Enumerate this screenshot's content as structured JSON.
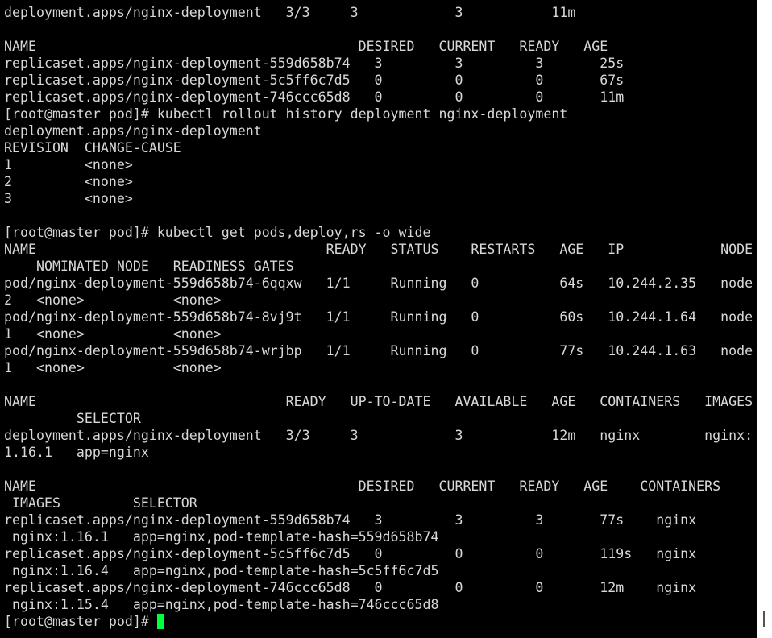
{
  "colors": {
    "background": "#000000",
    "foreground": "#d8d8d8",
    "cursor": "#00ff3c",
    "scrollbar": "#ffffff"
  },
  "terminal": {
    "lines": [
      "deployment.apps/nginx-deployment   3/3     3            3           11m",
      "",
      "NAME                                        DESIRED   CURRENT   READY   AGE",
      "replicaset.apps/nginx-deployment-559d658b74   3         3         3       25s",
      "replicaset.apps/nginx-deployment-5c5ff6c7d5   0         0         0       67s",
      "replicaset.apps/nginx-deployment-746ccc65d8   0         0         0       11m",
      "[root@master pod]# kubectl rollout history deployment nginx-deployment",
      "deployment.apps/nginx-deployment",
      "REVISION  CHANGE-CAUSE",
      "1         <none>",
      "2         <none>",
      "3         <none>",
      "",
      "[root@master pod]# kubectl get pods,deploy,rs -o wide",
      "NAME                                    READY   STATUS    RESTARTS   AGE   IP            NODE",
      "    NOMINATED NODE   READINESS GATES",
      "pod/nginx-deployment-559d658b74-6qqxw   1/1     Running   0          64s   10.244.2.35   node",
      "2   <none>           <none>",
      "pod/nginx-deployment-559d658b74-8vj9t   1/1     Running   0          60s   10.244.1.64   node",
      "1   <none>           <none>",
      "pod/nginx-deployment-559d658b74-wrjbp   1/1     Running   0          77s   10.244.1.63   node",
      "1   <none>           <none>",
      "",
      "NAME                               READY   UP-TO-DATE   AVAILABLE   AGE   CONTAINERS   IMAGES",
      "         SELECTOR",
      "deployment.apps/nginx-deployment   3/3     3            3           12m   nginx        nginx:",
      "1.16.1   app=nginx",
      "",
      "NAME                                        DESIRED   CURRENT   READY   AGE    CONTAINERS",
      " IMAGES         SELECTOR",
      "replicaset.apps/nginx-deployment-559d658b74   3         3         3       77s    nginx",
      " nginx:1.16.1   app=nginx,pod-template-hash=559d658b74",
      "replicaset.apps/nginx-deployment-5c5ff6c7d5   0         0         0       119s   nginx",
      " nginx:1.16.4   app=nginx,pod-template-hash=5c5ff6c7d5",
      "replicaset.apps/nginx-deployment-746ccc65d8   0         0         0       12m    nginx",
      " nginx:1.15.4   app=nginx,pod-template-hash=746ccc65d8"
    ],
    "prompt": "[root@master pod]# "
  }
}
